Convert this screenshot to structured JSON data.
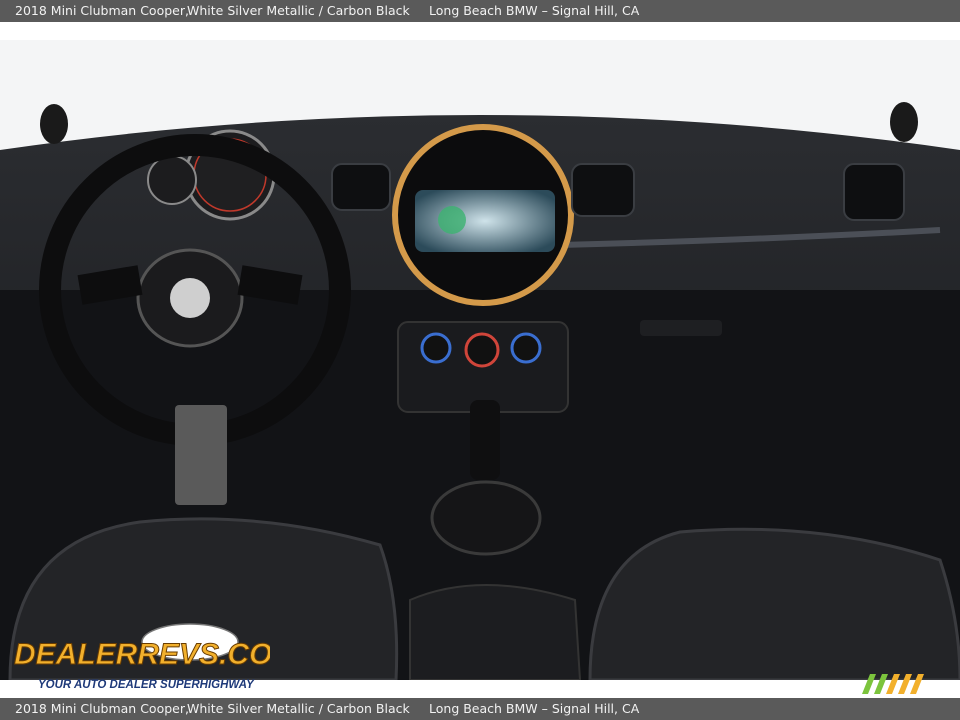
{
  "caption": {
    "vehicle": "2018 Mini Clubman Cooper,",
    "colors": "White Silver Metallic / Carbon Black",
    "dealer": "Long Beach BMW – Signal Hill, CA"
  },
  "watermark": {
    "brand": "DealerRevs.com",
    "tagline": "YOUR AUTO DEALER SUPERHIGHWAY"
  },
  "photo": {
    "subject": "car-interior-dashboard"
  }
}
